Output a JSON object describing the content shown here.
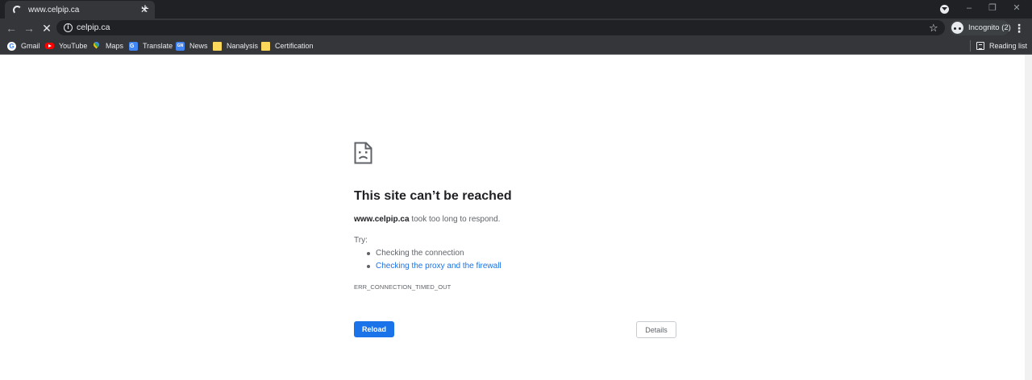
{
  "browser": {
    "tab": {
      "title": "www.celpip.ca",
      "close_glyph": "✕"
    },
    "new_tab_glyph": "+",
    "window_controls": {
      "minimize": "–",
      "restore": "❐",
      "close": "✕"
    },
    "nav": {
      "back": "←",
      "forward": "→",
      "stop": "✕"
    },
    "omnibox": {
      "info_glyph": "i",
      "url": "celpip.ca",
      "star_glyph": "☆"
    },
    "profile": {
      "label": "Incognito (2)"
    },
    "menu_glyph": "⋮",
    "bookmarks": [
      {
        "label": "Gmail",
        "icon": "gmail-icon"
      },
      {
        "label": "YouTube",
        "icon": "youtube-icon"
      },
      {
        "label": "Maps",
        "icon": "maps-icon"
      },
      {
        "label": "Translate",
        "icon": "translate-icon"
      },
      {
        "label": "News",
        "icon": "news-icon"
      },
      {
        "label": "Nanalysis",
        "icon": "folder-icon"
      },
      {
        "label": "Certification",
        "icon": "folder-icon"
      }
    ],
    "reading_list": {
      "label": "Reading list"
    }
  },
  "error": {
    "icon": "sad-page-icon",
    "title": "This site can’t be reached",
    "host": "www.celpip.ca",
    "message": " took too long to respond.",
    "try_label": "Try:",
    "suggestions": [
      {
        "text": "Checking the connection",
        "link": false
      },
      {
        "text": "Checking the proxy and the firewall",
        "link": true
      }
    ],
    "code": "ERR_CONNECTION_TIMED_OUT",
    "reload_label": "Reload",
    "details_label": "Details"
  },
  "colors": {
    "chrome_dark": "#202124",
    "chrome_toolbar": "#35363a",
    "accent_blue": "#1a73e8",
    "text_gray": "#5f6368"
  }
}
